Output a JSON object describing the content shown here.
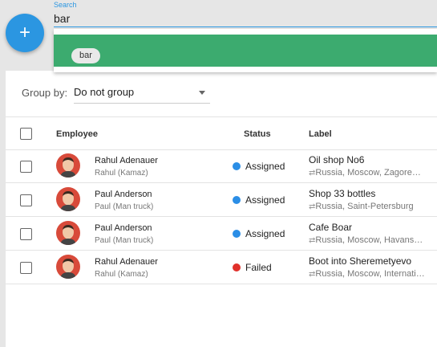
{
  "fab": {
    "icon": "plus-icon",
    "symbol": "+"
  },
  "search": {
    "label": "Search",
    "value": "bar"
  },
  "suggestion": {
    "chip": "bar"
  },
  "group_by": {
    "label": "Group by:",
    "value": "Do not group"
  },
  "table": {
    "columns": {
      "employee": "Employee",
      "status": "Status",
      "label": "Label"
    },
    "rows": [
      {
        "name": "Rahul Adenauer",
        "sub": "Rahul (Kamaz)",
        "status": "Assigned",
        "status_color": "#2b8ee6",
        "label": "Oil shop No6",
        "location": "Russia, Moscow, Zagorevskaya"
      },
      {
        "name": "Paul Anderson",
        "sub": "Paul (Man truck)",
        "status": "Assigned",
        "status_color": "#2b8ee6",
        "label": "Shop 33 bottles",
        "location": "Russia, Saint-Petersburg"
      },
      {
        "name": "Paul Anderson",
        "sub": "Paul (Man truck)",
        "status": "Assigned",
        "status_color": "#2b8ee6",
        "label": "Cafe Boar",
        "location": "Russia, Moscow, Havanskaya"
      },
      {
        "name": "Rahul Adenauer",
        "sub": "Rahul (Kamaz)",
        "status": "Failed",
        "status_color": "#e0302a",
        "label": "Boot into Sheremetyevo",
        "location": "Russia, Moscow, International"
      }
    ]
  },
  "colors": {
    "accent": "#2b96e1",
    "highlight": "#3cab6f"
  }
}
